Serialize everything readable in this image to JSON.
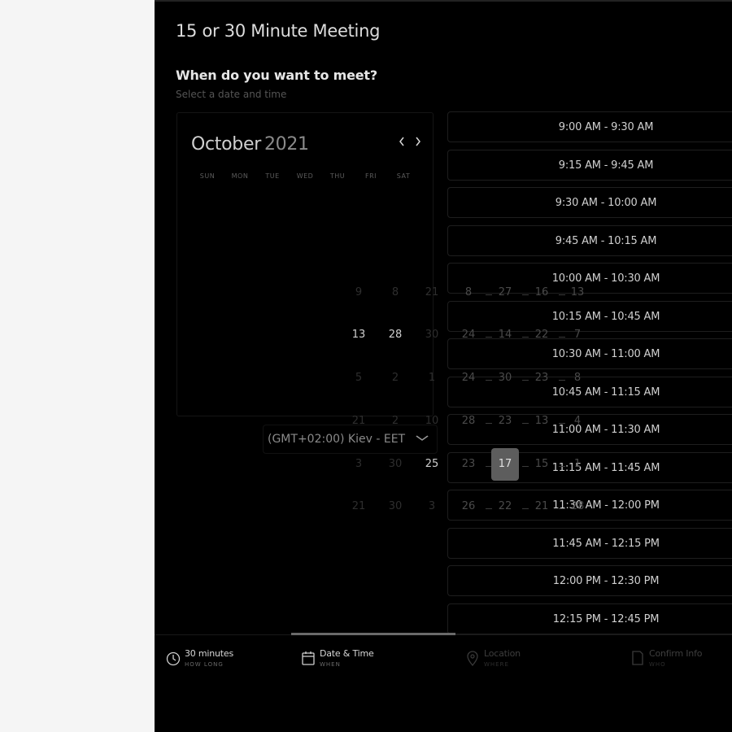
{
  "meeting": {
    "title": "15 or 30 Minute Meeting",
    "question": "When do you want to meet?",
    "hint": "Select a date and time"
  },
  "calendar": {
    "month": "October",
    "year": "2021",
    "prev_icon": "chevron-left-icon",
    "next_icon": "chevron-right-icon",
    "weekdays": [
      "SUN",
      "MON",
      "TUE",
      "WED",
      "THU",
      "FRI",
      "SAT"
    ],
    "selected_day": "17",
    "overlay_rows": [
      [
        "9",
        "8",
        "21",
        "8",
        "27",
        "16",
        "13"
      ],
      [
        "13",
        "28",
        "30",
        "24",
        "14",
        "22",
        "7"
      ],
      [
        "5",
        "2",
        "1",
        "24",
        "30",
        "23",
        "8"
      ],
      [
        "21",
        "2",
        "10",
        "28",
        "23",
        "13",
        "4"
      ],
      [
        "3",
        "30",
        "25",
        "23",
        "17",
        "15",
        "1"
      ],
      [
        "21",
        "30",
        "3",
        "26",
        "22",
        "21",
        "28"
      ]
    ]
  },
  "timezone": {
    "label": "(GMT+02:00) Kiev - EET",
    "chevron_icon": "chevron-down-icon"
  },
  "slots": [
    "9:00 AM - 9:30 AM",
    "9:15 AM - 9:45 AM",
    "9:30 AM - 10:00 AM",
    "9:45 AM - 10:15 AM",
    "10:00 AM - 10:30 AM",
    "10:15 AM - 10:45 AM",
    "10:30 AM - 11:00 AM",
    "10:45 AM - 11:15 AM",
    "11:00 AM - 11:30 AM",
    "11:15 AM - 11:45 AM",
    "11:30 AM - 12:00 PM",
    "11:45 AM - 12:15 PM",
    "12:00 PM - 12:30 PM",
    "12:15 PM - 12:45 PM"
  ],
  "steps": [
    {
      "label": "30 minutes",
      "sub": "HOW LONG",
      "icon": "clock-icon"
    },
    {
      "label": "Date & Time",
      "sub": "WHEN",
      "icon": "calendar-icon"
    },
    {
      "label": "Location",
      "sub": "WHERE",
      "icon": "location-pin-icon"
    },
    {
      "label": "Confirm Info",
      "sub": "WHO",
      "icon": "document-icon"
    }
  ],
  "progress_step": 2,
  "colors": {
    "panel_bg": "#000000",
    "page_bg": "#f5f5f5",
    "selected_day_bg": "#5d5d5d",
    "progress_bar": "#6a6a6a"
  }
}
